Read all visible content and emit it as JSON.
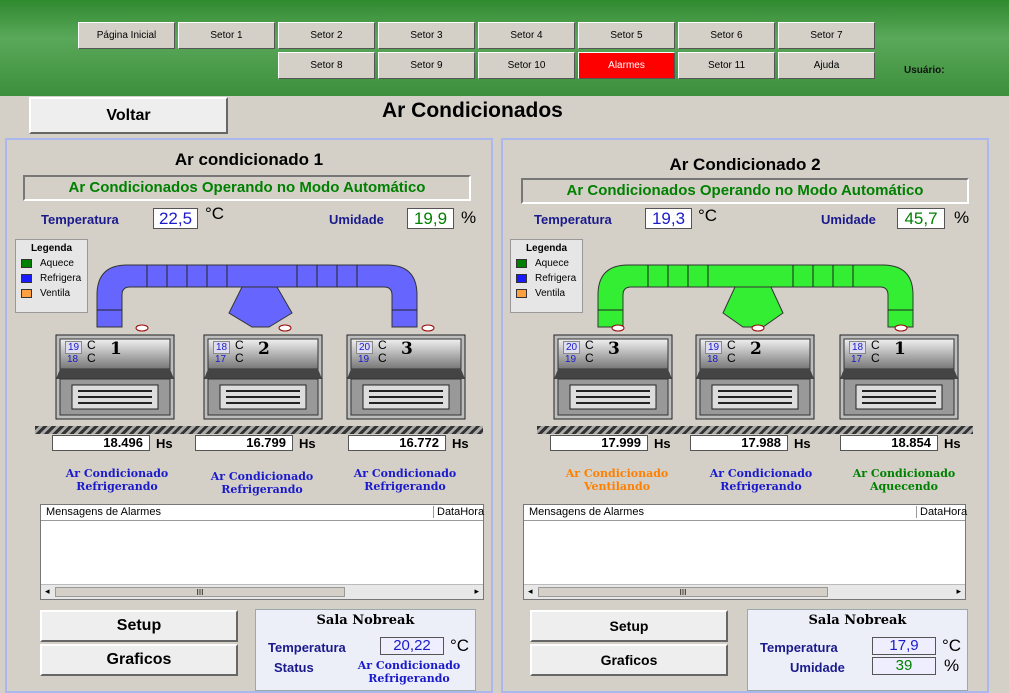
{
  "nav": {
    "row1": [
      "Página Inicial",
      "Setor 1",
      "Setor 2",
      "Setor 3",
      "Setor 4",
      "Setor 5",
      "Setor 6",
      "Setor 7"
    ],
    "row2": [
      "Setor 8",
      "Setor 9",
      "Setor 10",
      "Alarmes",
      "Setor 11",
      "Ajuda"
    ],
    "usuario": "Usuário:"
  },
  "page": {
    "back": "Voltar",
    "title": "Ar Condicionados"
  },
  "left": {
    "title": "Ar condicionado 1",
    "mode": "Ar Condicionados Operando no Modo Automático",
    "temp_label": "Temperatura",
    "temp": "22,5",
    "temp_unit": "°C",
    "hum_label": "Umidade",
    "hum": "19,9",
    "hum_unit": "%",
    "legend": {
      "title": "Legenda",
      "heat": "Aquece",
      "cool": "Refrigera",
      "fan": "Ventila"
    },
    "duct_color": "#6666ff",
    "units": [
      {
        "num": "1",
        "t1": "19",
        "t2": "18",
        "c": "C",
        "hours": "18.496",
        "status1": "Ar Condicionado",
        "status2": "Refrigerando",
        "color": "#1a1acc"
      },
      {
        "num": "2",
        "t1": "18",
        "t2": "17",
        "c": "C",
        "hours": "16.799",
        "status1": "Ar Condicionado",
        "status2": "Refrigerando",
        "color": "#1a1acc"
      },
      {
        "num": "3",
        "t1": "20",
        "t2": "19",
        "c": "C",
        "hours": "16.772",
        "status1": "Ar Condicionado",
        "status2": "Refrigerando",
        "color": "#1a1acc"
      }
    ],
    "hs": "Hs",
    "alarm_col1": "Mensagens de Alarmes",
    "alarm_col2": "DataHora",
    "scroll": "III",
    "setup": "Setup",
    "graficos": "Graficos",
    "nb": {
      "title": "Sala Nobreak",
      "l1": "Temperatura",
      "v1": "20,22",
      "u1": "°C",
      "l2": "Status",
      "s1": "Ar Condicionado",
      "s2": "Refrigerando"
    }
  },
  "right": {
    "title": "Ar Condicionado 2",
    "mode": "Ar Condicionados Operando no Modo Automático",
    "temp_label": "Temperatura",
    "temp": "19,3",
    "temp_unit": "°C",
    "hum_label": "Umidade",
    "hum": "45,7",
    "hum_unit": "%",
    "legend": {
      "title": "Legenda",
      "heat": "Aquece",
      "cool": "Refrigera",
      "fan": "Ventila"
    },
    "duct_color": "#33ee33",
    "units": [
      {
        "num": "3",
        "t1": "20",
        "t2": "19",
        "c": "C",
        "hours": "17.999",
        "status1": "Ar Condicionado",
        "status2": "Ventilando",
        "color": "#ff8000"
      },
      {
        "num": "2",
        "t1": "19",
        "t2": "18",
        "c": "C",
        "hours": "17.988",
        "status1": "Ar Condicionado",
        "status2": "Refrigerando",
        "color": "#1a1acc"
      },
      {
        "num": "1",
        "t1": "18",
        "t2": "17",
        "c": "C",
        "hours": "18.854",
        "status1": "Ar Condicionado",
        "status2": "Aquecendo",
        "color": "#008000"
      }
    ],
    "hs": "Hs",
    "alarm_col1": "Mensagens de Alarmes",
    "alarm_col2": "DataHora",
    "scroll": "III",
    "setup": "Setup",
    "graficos": "Graficos",
    "nb": {
      "title": "Sala Nobreak",
      "l1": "Temperatura",
      "v1": "17,9",
      "u1": "°C",
      "l2": "Umidade",
      "v2": "39",
      "u2": "%"
    }
  }
}
